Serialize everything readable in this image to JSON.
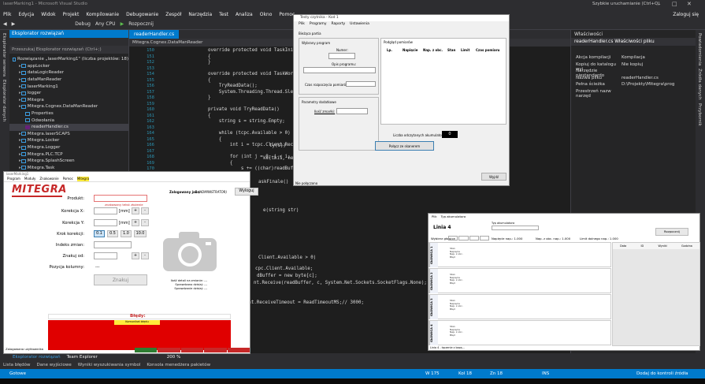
{
  "vs": {
    "title": "laserMarking1 - Microsoft Visual Studio",
    "quick_launch": "Szybkie uruchamianie (Ctrl+Q)",
    "signin": "Zaloguj się",
    "menu": [
      "Plik",
      "Edycja",
      "Widok",
      "Projekt",
      "Kompilowanie",
      "Debugowanie",
      "Zespół",
      "Narzędzia",
      "Test",
      "Analiza",
      "Okno",
      "Pomoc"
    ],
    "toolbar": {
      "config": "Debug",
      "platform": "Any CPU",
      "start": "Rozpocznij"
    },
    "left_strip": [
      "Eksplorator serwera",
      "Eksplorator danych",
      "Przybornik"
    ],
    "right_strip": [
      "Powiadomienia",
      "Źródła danych",
      "Przybornik"
    ]
  },
  "solution": {
    "header": "Eksplorator rozwiązań",
    "search": "Przeszukaj Eksplorator rozwiązań (Ctrl+;)",
    "items": [
      {
        "label": "Rozwiązanie „laserMarking1\" (liczba projektów: 18)",
        "indent": 0
      },
      {
        "label": "appLocker",
        "indent": 1
      },
      {
        "label": "dataLogicReader",
        "indent": 1
      },
      {
        "label": "dataManReader",
        "indent": 1
      },
      {
        "label": "laserMarking1",
        "indent": 1
      },
      {
        "label": "logger",
        "indent": 1
      },
      {
        "label": "Mitegra",
        "indent": 1
      },
      {
        "label": "Mitegra.Cognex.DataManReader",
        "indent": 1
      },
      {
        "label": "Properties",
        "indent": 2
      },
      {
        "label": "Odwołania",
        "indent": 2
      },
      {
        "label": "readerHandler.cs",
        "indent": 2
      },
      {
        "label": "Mitegra.laserSCAPS",
        "indent": 1
      },
      {
        "label": "Mitegra.Locker",
        "indent": 1
      },
      {
        "label": "Mitegra.Logger",
        "indent": 1
      },
      {
        "label": "Mitegra.PLC.TCP",
        "indent": 1
      },
      {
        "label": "Mitegra.SplashScreen",
        "indent": 1
      },
      {
        "label": "Mitegra.Task",
        "indent": 1
      }
    ]
  },
  "editor": {
    "tab": "readerHandler.cs",
    "nav": "Mitegra.Cognex.DataManReader",
    "lines": [
      {
        "n": "150",
        "t": "    override protected void TaskInit()"
      },
      {
        "n": "151",
        "t": "    {"
      },
      {
        "n": "152",
        "t": "    }"
      },
      {
        "n": "153",
        "t": ""
      },
      {
        "n": "154",
        "t": "    override protected void TaskWork()"
      },
      {
        "n": "155",
        "t": "    {"
      },
      {
        "n": "156",
        "t": "        TryReadData();"
      },
      {
        "n": "157",
        "t": "        System.Threading.Thread.Sleep(10);"
      },
      {
        "n": "158",
        "t": "    }"
      },
      {
        "n": "159",
        "t": ""
      },
      {
        "n": "160",
        "t": "    private void TryReadData()"
      },
      {
        "n": "161",
        "t": "    {"
      },
      {
        "n": "162",
        "t": "        string s = string.Empty;"
      },
      {
        "n": "163",
        "t": ""
      },
      {
        "n": "164",
        "t": "        while (tcpc.Available > 0)"
      },
      {
        "n": "165",
        "t": "        {"
      },
      {
        "n": "166",
        "t": "            int i = tcpc.Client.Receive(re"
      },
      {
        "n": "167",
        "t": ""
      },
      {
        "n": "168",
        "t": "            for (int j = 0; j < i; j++)"
      },
      {
        "n": "169",
        "t": "            {"
      },
      {
        "n": "170",
        "t": "                s += ((char)readBuffer[j])"
      }
    ],
    "fragments": [
      "ty(s))",
      "ke(this, new ReaderNewDataEventArgs(s));",
      "askFinale()",
      "e(string str)",
      "Client.Available > 0)",
      "cpc.Client.Available;",
      "dBuffer = new byte[c];",
      "nt.Receive(readBuffer, c, System.Net.Sockets.SocketFlags.None);",
      "tcpc.Client.ReceiveTimeout = ReadTimeoutMS;// 3000;"
    ]
  },
  "properties": {
    "header": "Właściwości",
    "file": "readerHandler.cs  Właściwości pliku",
    "rows": [
      {
        "k": "Akcja kompilacji",
        "v": "Kompilacja"
      },
      {
        "k": "Kopiuj do katalogu wyj",
        "v": "Nie kopiuj"
      },
      {
        "k": "Narzędzie niestandardo",
        "v": ""
      },
      {
        "k": "Nazwa pliku",
        "v": "readerHandler.cs"
      },
      {
        "k": "Pełna ścieżka",
        "v": "D:\\Projekty\\Mitegra\\prog"
      },
      {
        "k": "Przestrzeń nazw narzęd",
        "v": ""
      }
    ]
  },
  "bottom": {
    "tabs": [
      "Eksplorator rozwiązań",
      "Team Explorer"
    ],
    "zoom": "200 %",
    "output_tabs": [
      "Lista błędów",
      "Dane wyjściowe",
      "Wyniki wyszukiwania symbol",
      "Konsola menedżera pakietów"
    ],
    "status": {
      "ready": "Gotowe",
      "line": "W 175",
      "col": "Kol 18",
      "ch": "Zn 18",
      "ins": "INS",
      "source": "Dodaj do kontroli źródła"
    }
  },
  "win1": {
    "title": "Testy czytnika - Kod 1",
    "menu": [
      "Plik",
      "Programy",
      "Raporty",
      "Ustawienia"
    ],
    "tab": "Bieżąca partia",
    "group1": "Wybrany program",
    "numer": "Numer:",
    "opis": "Opis programu:",
    "czas": "Czas rozpoczęcia pomiarów:",
    "group2": "Parametry dodatkowe",
    "ilosc": "Ilość zmarłki:",
    "group3": "Podgląd pomiarów",
    "cols": [
      "Lp.",
      "Napięcie",
      "Nap. z obc.",
      "Stan",
      "Limit",
      "Czas pomiaru"
    ],
    "counter_label": "Liczba odczytanych akumulatorów",
    "counter_value": "0",
    "connect": "Połącz ze skanerem",
    "close": "Wyjdź",
    "status": "Nie połączono"
  },
  "win2": {
    "title": "laserMarking1",
    "menu": [
      "Program",
      "Moduły",
      "Znakowanie",
      "Pomoc",
      "Mitegra"
    ],
    "logo": "MITEGRA",
    "logged": "Zalogowany jako:",
    "user": "1 (ADMINISTRATOR)",
    "logout": "Wyloguj",
    "produkt": "Produkt:",
    "produkt_note": "znakowany tekst złożenie",
    "korx": "Korekcja X:",
    "kory": "Korekcja Y:",
    "mm": "[mm]",
    "plus": "+",
    "minus": "-",
    "krok": "Krok korekcji:",
    "steps": [
      "0.1",
      "0.5",
      "1.0",
      "10.0"
    ],
    "indeks": "Indeks zmian:",
    "znakuj_od": "Znakuj od:",
    "pozycja": "Pozycja kolumny:",
    "pozycja_val": "---",
    "znakuj": "Znakuj",
    "stats": [
      "Ilość detali na zmianie: ---",
      "Sprawdzono dzisiaj: ---",
      "Sprawdzanie dzisiaj: ---"
    ],
    "bledy": "Błędy:",
    "error_line": "Komunikat błędu",
    "status": "Zalogowano użytkownika"
  },
  "win3": {
    "menu": [
      "Plik",
      "Typ akumulatora"
    ],
    "title": "Linia 4",
    "type": "Typ akumulatora",
    "buttons_label": "Wybierz głowicę",
    "napiecie": "Napięcie nap.: 1.000",
    "nap_obc": "Nap. z obc. nap.: 1.000",
    "limit": "Limit dolnego nap.: 1.000",
    "start": "Rozpocznij",
    "heads": [
      "GŁOWICA 1",
      "GŁOWICA 2",
      "GŁOWICA 3",
      "GŁOWICA 4"
    ],
    "legend": [
      "Stan",
      "Napięcie",
      "Nap. z obc.",
      "Błąd"
    ],
    "table_cols": [
      "Data",
      "ID",
      "Wyniki",
      "Godzina"
    ],
    "footer": "Linia 4 - łączenie z bazą..."
  }
}
